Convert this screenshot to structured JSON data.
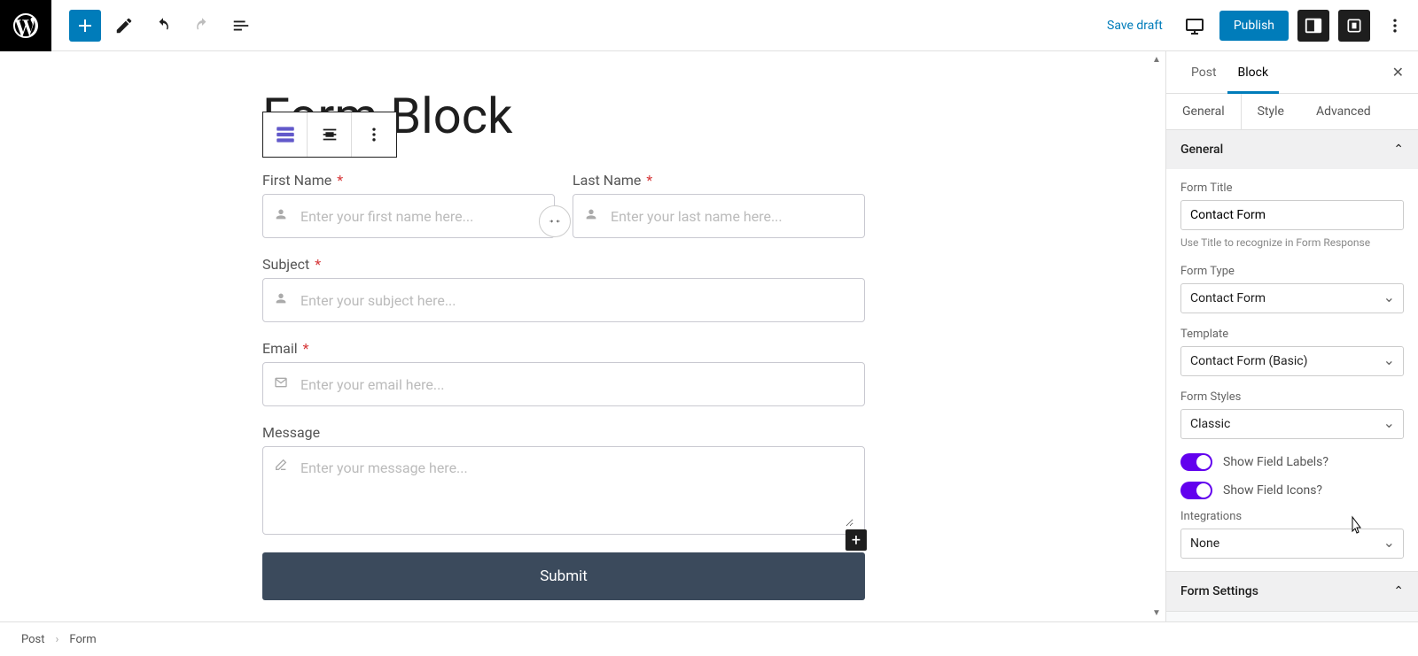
{
  "topbar": {
    "save_draft": "Save draft",
    "publish": "Publish"
  },
  "editor": {
    "page_title": "Form Block",
    "fields": {
      "first_name": {
        "label": "First Name",
        "placeholder": "Enter your first name here...",
        "required": true
      },
      "last_name": {
        "label": "Last Name",
        "placeholder": "Enter your last name here...",
        "required": true
      },
      "subject": {
        "label": "Subject",
        "placeholder": "Enter your subject here...",
        "required": true
      },
      "email": {
        "label": "Email",
        "placeholder": "Enter your email here...",
        "required": true
      },
      "message": {
        "label": "Message",
        "placeholder": "Enter your message here...",
        "required": false
      }
    },
    "submit_label": "Submit"
  },
  "sidebar": {
    "tabs": {
      "post": "Post",
      "block": "Block"
    },
    "subtabs": {
      "general": "General",
      "style": "Style",
      "advanced": "Advanced"
    },
    "sections": {
      "general": {
        "title": "General",
        "form_title": {
          "label": "Form Title",
          "value": "Contact Form",
          "help": "Use Title to recognize in Form Response"
        },
        "form_type": {
          "label": "Form Type",
          "value": "Contact Form"
        },
        "template": {
          "label": "Template",
          "value": "Contact Form (Basic)"
        },
        "form_styles": {
          "label": "Form Styles",
          "value": "Classic"
        },
        "show_labels": {
          "label": "Show Field Labels?"
        },
        "show_icons": {
          "label": "Show Field Icons?"
        },
        "integrations": {
          "label": "Integrations",
          "value": "None"
        }
      },
      "form_settings": {
        "title": "Form Settings"
      }
    }
  },
  "breadcrumb": {
    "root": "Post",
    "current": "Form"
  },
  "icons": {
    "user": "user-icon",
    "envelope": "envelope-icon",
    "edit": "edit-icon"
  }
}
